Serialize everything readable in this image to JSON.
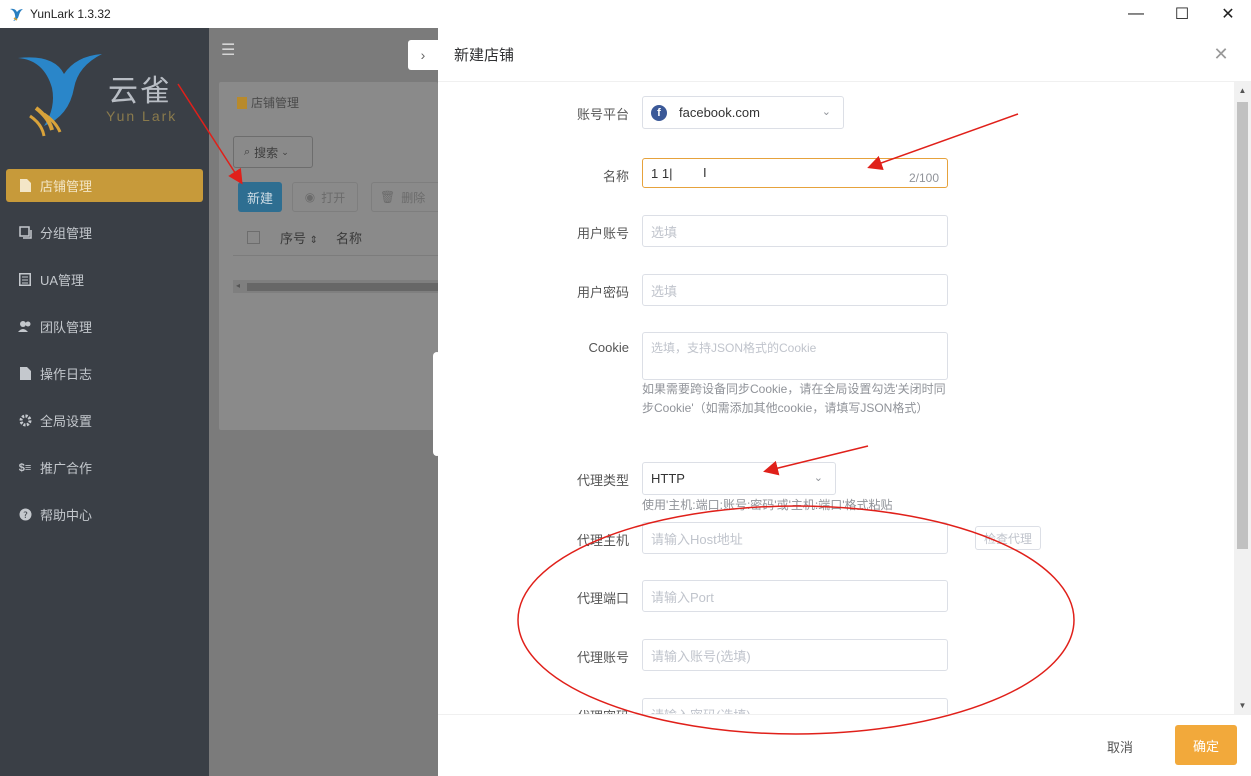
{
  "window": {
    "title": "YunLark 1.3.32",
    "minimize": "—",
    "maximize": "☐",
    "close": "✕"
  },
  "sidebar": {
    "logo_cn": "云雀",
    "logo_en": "Yun Lark",
    "items": [
      {
        "label": "店铺管理",
        "icon": "document-icon",
        "active": true
      },
      {
        "label": "分组管理",
        "icon": "group-icon"
      },
      {
        "label": "UA管理",
        "icon": "list-icon"
      },
      {
        "label": "团队管理",
        "icon": "team-icon"
      },
      {
        "label": "操作日志",
        "icon": "log-icon"
      },
      {
        "label": "全局设置",
        "icon": "gear-icon"
      },
      {
        "label": "推广合作",
        "icon": "promo-icon"
      },
      {
        "label": "帮助中心",
        "icon": "help-icon"
      }
    ]
  },
  "main": {
    "breadcrumb": "店铺管理",
    "search_label": "搜索",
    "btn_new": "新建",
    "btn_open": "打开",
    "btn_delete": "删除",
    "col_index": "序号",
    "col_name": "名称"
  },
  "drawer": {
    "title": "新建店铺",
    "fields": {
      "platform": {
        "label": "账号平台",
        "value": "facebook.com"
      },
      "name": {
        "label": "名称",
        "value": "1 1",
        "counter": "2/100"
      },
      "user_account": {
        "label": "用户账号",
        "placeholder": "选填"
      },
      "user_password": {
        "label": "用户密码",
        "placeholder": "选填"
      },
      "cookie": {
        "label": "Cookie",
        "placeholder": "选填，支持JSON格式的Cookie",
        "hint": "如果需要跨设备同步Cookie，请在全局设置勾选'关闭时同步Cookie'（如需添加其他cookie，请填写JSON格式）"
      },
      "proxy_type": {
        "label": "代理类型",
        "value": "HTTP",
        "hint": "使用'主机:端口:账号:密码'或'主机:端口'格式粘贴"
      },
      "proxy_host": {
        "label": "代理主机",
        "placeholder": "请输入Host地址",
        "check_btn": "检查代理"
      },
      "proxy_port": {
        "label": "代理端口",
        "placeholder": "请输入Port"
      },
      "proxy_account": {
        "label": "代理账号",
        "placeholder": "请输入账号(选填)"
      },
      "proxy_password": {
        "label": "代理密码",
        "placeholder": "请输入密码(选填)"
      }
    },
    "btn_cancel": "取消",
    "btn_ok": "确定"
  },
  "colors": {
    "accent": "#f2a93b",
    "sidebar_bg": "#3a3f46",
    "annotation": "#e0201a"
  }
}
